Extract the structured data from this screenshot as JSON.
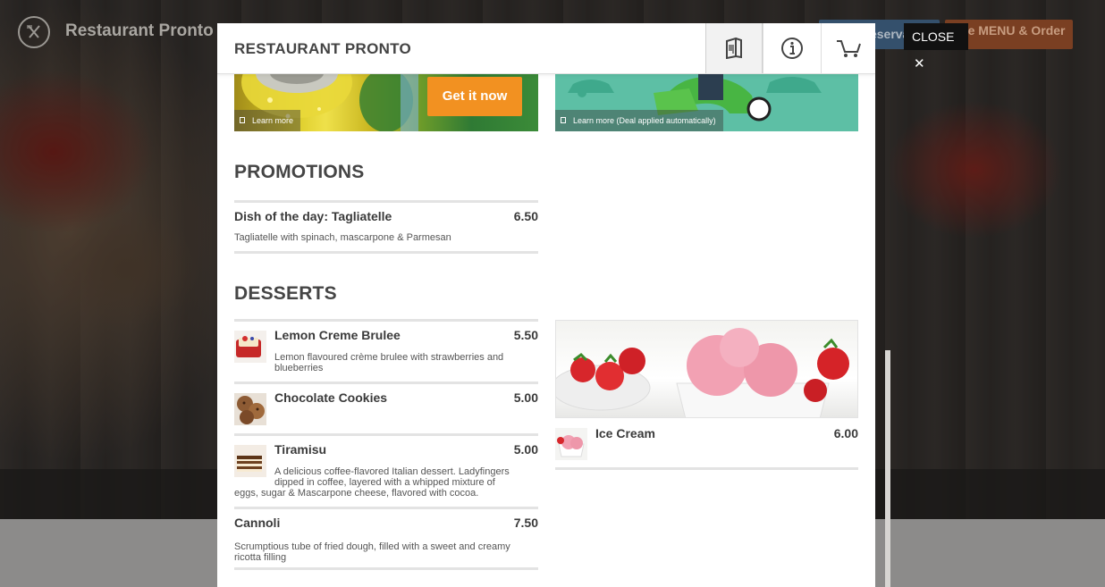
{
  "site": {
    "name": "Restaurant Pronto",
    "reservation_label": "Reservation",
    "menu_order_label": "See MENU & Order"
  },
  "modal": {
    "title": "RESTAURANT PRONTO",
    "close_label": "CLOSE",
    "header_icons": [
      "menu-book-icon",
      "info-icon",
      "cart-icon"
    ]
  },
  "banners": [
    {
      "cta": "Get it now",
      "learn_more": "Learn more"
    },
    {
      "learn_more": "Learn more (Deal applied automatically)"
    }
  ],
  "promotions": {
    "title": "PROMOTIONS",
    "items": [
      {
        "name": "Dish of the day: Tagliatelle",
        "price": "6.50",
        "description": "Tagliatelle with spinach, mascarpone & Parmesan"
      }
    ]
  },
  "desserts": {
    "title": "DESSERTS",
    "items": [
      {
        "name": "Lemon Creme Brulee",
        "price": "5.50",
        "description": "Lemon flavoured crème brulee with strawberries and blueberries"
      },
      {
        "name": "Chocolate Cookies",
        "price": "5.00",
        "description": ""
      },
      {
        "name": "Tiramisu",
        "price": "5.00",
        "description": "A delicious coffee-flavored Italian dessert. Ladyfingers dipped in coffee, layered with a whipped mixture of eggs, sugar & Mascarpone cheese, flavored with cocoa."
      },
      {
        "name": "Cannoli",
        "price": "7.50",
        "description": "Scrumptious tube of fried dough, filled with a sweet and creamy ricotta filling"
      },
      {
        "name": "Ice Cream",
        "price": "6.00",
        "description": ""
      }
    ]
  },
  "colors": {
    "cta_orange": "#f29121",
    "reservation_blue": "#34506c",
    "menu_order_brown": "#7a3f22",
    "heading_gray": "#454545"
  }
}
